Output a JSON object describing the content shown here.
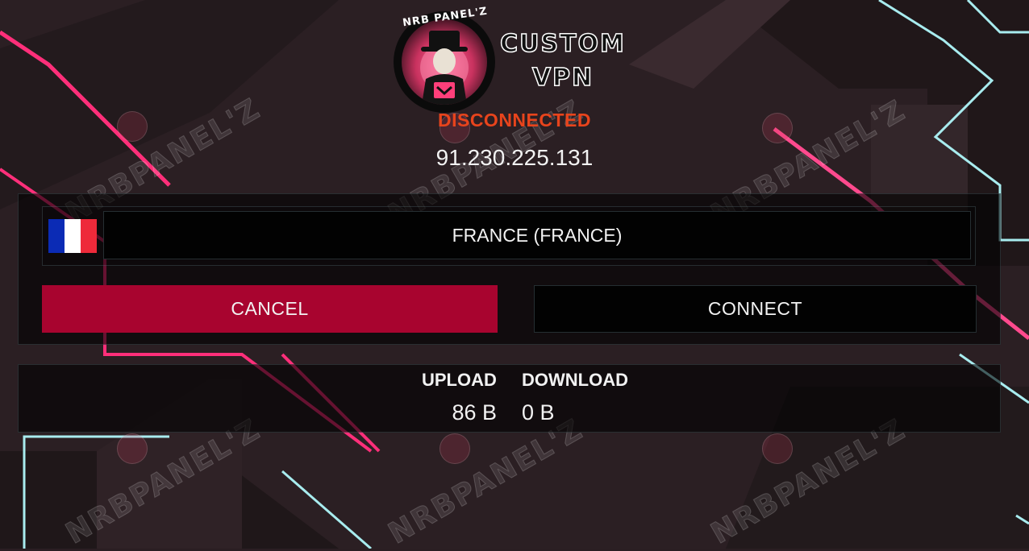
{
  "header": {
    "logo_text": "NRB PANEL'Z",
    "title_line1": "CUSTOM",
    "title_line2": "VPN"
  },
  "status": {
    "text": "DISCONNECTED",
    "ip": "91.230.225.131"
  },
  "server": {
    "name": "FRANCE (FRANCE)",
    "flag_icon": "france-flag-icon",
    "flag_colors": [
      "#0b2bb5",
      "#ffffff",
      "#ee2a3a"
    ]
  },
  "actions": {
    "cancel_label": "CANCEL",
    "connect_label": "CONNECT"
  },
  "traffic": {
    "upload_label": "UPLOAD",
    "download_label": "DOWNLOAD",
    "upload_value": "86 B",
    "download_value": "0 B"
  },
  "watermark": "NRBPANEL'Z",
  "colors": {
    "status": "#e8441c",
    "cancel_button": "#a8042f",
    "accent_pink": "#ff2f7a",
    "accent_cyan": "#9fe6ec"
  }
}
